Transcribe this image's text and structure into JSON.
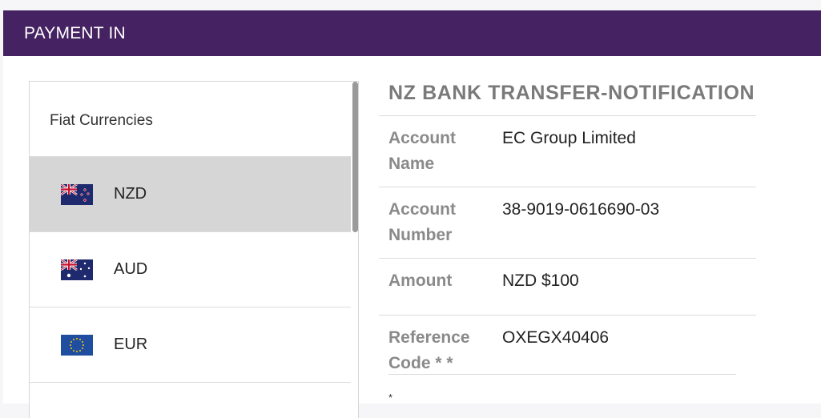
{
  "header": {
    "title": "PAYMENT IN"
  },
  "currency_list": {
    "heading": "Fiat Currencies",
    "items": [
      {
        "code": "NZD",
        "flag_icon": "nz-flag-icon",
        "selected": true
      },
      {
        "code": "AUD",
        "flag_icon": "au-flag-icon",
        "selected": false
      },
      {
        "code": "EUR",
        "flag_icon": "eu-flag-icon",
        "selected": false
      }
    ]
  },
  "details": {
    "title": "NZ BANK TRANSFER-NOTIFICATION",
    "rows": [
      {
        "label": "Account Name",
        "value": "EC Group Limited"
      },
      {
        "label": "Account Number",
        "value": "38-9019-0616690-03"
      },
      {
        "label": "Amount",
        "value": "NZD $100"
      },
      {
        "label": "Reference Code * *",
        "value": "OXEGX40406"
      }
    ],
    "footnote": "*"
  },
  "colors": {
    "header_bg": "#452261",
    "selected_bg": "#d6d6d6",
    "label_gray": "#8a8a8a"
  }
}
